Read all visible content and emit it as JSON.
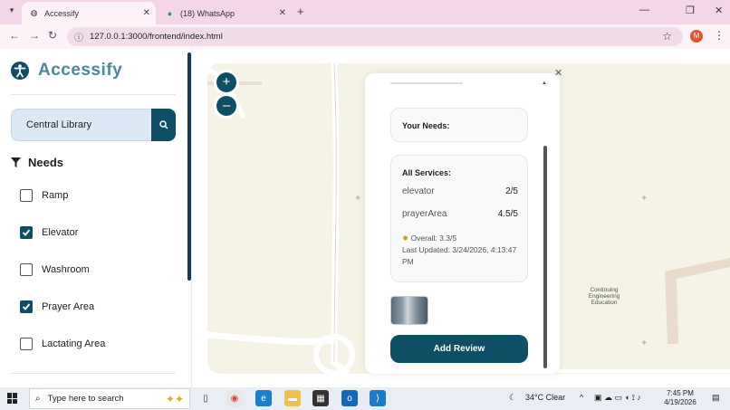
{
  "browser": {
    "tabs": [
      {
        "title": "Accessify",
        "active": true
      },
      {
        "title": "(18) WhatsApp",
        "active": false
      }
    ],
    "url": "127.0.0.1:3000/frontend/index.html",
    "profile_initial": "M"
  },
  "sidebar": {
    "brand": "Accessify",
    "search": {
      "value": "Central Library"
    },
    "needs_title": "Needs",
    "needs": [
      {
        "label": "Ramp",
        "checked": false
      },
      {
        "label": "Elevator",
        "checked": true
      },
      {
        "label": "Washroom",
        "checked": false
      },
      {
        "label": "Prayer Area",
        "checked": true
      },
      {
        "label": "Lactating Area",
        "checked": false
      }
    ]
  },
  "map": {
    "zoom_in": "+",
    "zoom_out": "–",
    "label": "Continuing Engineering Education"
  },
  "panel": {
    "your_needs_title": "Your Needs:",
    "all_services_title": "All Services:",
    "services": [
      {
        "name": "elevator",
        "score": "2/5"
      },
      {
        "name": "prayerArea",
        "score": "4.5/5"
      }
    ],
    "overall": "Overall: 3.3/5",
    "last_updated": "Last Updated: 3/24/2026, 4:13:47 PM",
    "add_review_label": "Add Review"
  },
  "taskbar": {
    "search_placeholder": "Type here to search",
    "weather": "34°C  Clear",
    "time": "7:45 PM",
    "date": "4/19/2026"
  },
  "colors": {
    "primary": "#0e4f66",
    "brand_text": "#4b8a99",
    "browser_chrome": "#f4d6e8"
  }
}
